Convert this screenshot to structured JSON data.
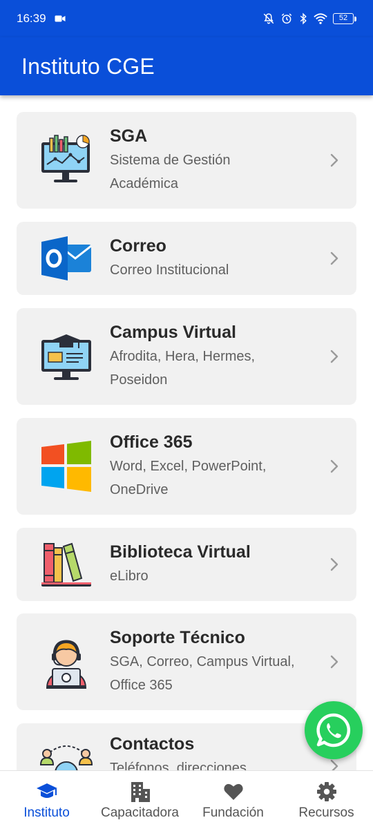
{
  "status_bar": {
    "time": "16:39",
    "battery": "52",
    "icons": [
      "video-record-icon",
      "notifications-off-icon",
      "alarm-icon",
      "bluetooth-icon",
      "wifi-icon",
      "battery-icon"
    ]
  },
  "app_bar": {
    "title": "Instituto CGE"
  },
  "cards": [
    {
      "title": "SGA",
      "subtitle_lines": [
        "Sistema de Gestión",
        "Académica"
      ],
      "icon": "analytics-monitor-icon"
    },
    {
      "title": "Correo",
      "subtitle_lines": [
        "Correo Institucional"
      ],
      "icon": "outlook-mail-icon"
    },
    {
      "title": "Campus Virtual",
      "subtitle_lines": [
        "Afrodita, Hera, Hermes,",
        "Poseidon"
      ],
      "icon": "graduation-monitor-icon"
    },
    {
      "title": "Office 365",
      "subtitle_lines": [
        "Word, Excel, PowerPoint,",
        "OneDrive"
      ],
      "icon": "windows-logo-icon"
    },
    {
      "title": "Biblioteca Virtual",
      "subtitle_lines": [
        "eLibro"
      ],
      "icon": "books-icon"
    },
    {
      "title": "Soporte Técnico",
      "subtitle_lines": [
        "SGA, Correo, Campus Virtual,",
        "Office 365"
      ],
      "icon": "support-agent-icon"
    },
    {
      "title": "Contactos",
      "subtitle_lines": [
        "Teléfonos, direcciones"
      ],
      "icon": "contacts-network-icon"
    }
  ],
  "bottom_nav": [
    {
      "label": "Instituto",
      "icon": "graduation-cap-icon",
      "active": true
    },
    {
      "label": "Capacitadora",
      "icon": "building-icon",
      "active": false
    },
    {
      "label": "Fundación",
      "icon": "heart-icon",
      "active": false
    },
    {
      "label": "Recursos",
      "icon": "gear-icon",
      "active": false
    }
  ],
  "colors": {
    "primary": "#0a4fd9",
    "card_background": "#f1f1f1",
    "whatsapp_green": "#27cf5d",
    "active_nav": "#0a4fd9",
    "inactive_nav": "#555555"
  }
}
